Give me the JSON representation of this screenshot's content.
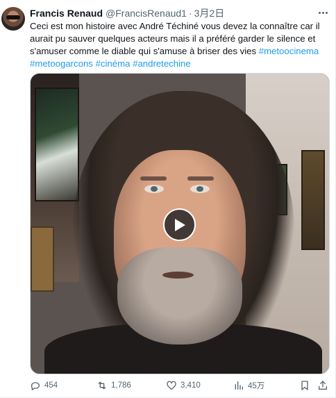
{
  "tweet": {
    "author_name": "Francis Renaud",
    "handle": "@FrancisRenaud1",
    "separator": "·",
    "date": "3月2日",
    "text": "Ceci est mon histoire avec André Téchiné vous devez la connaître car il aurait pu sauver quelques acteurs mais il a préféré garder le silence et s'amuser comme le diable qui s'amuse à briser des vies ",
    "hashtags": [
      "#metoocinema",
      "#metoogarcons",
      "#cinéma",
      "#andretechine"
    ],
    "stats": {
      "replies": "454",
      "retweets": "1,786",
      "likes": "3,410",
      "views": "45万"
    }
  },
  "icons": {
    "more": "more-dots-icon",
    "reply": "reply-icon",
    "retweet": "retweet-icon",
    "like": "heart-icon",
    "views": "bar-chart-icon",
    "bookmark": "bookmark-icon",
    "share": "share-icon",
    "play": "play-icon"
  },
  "colors": {
    "accent": "#1d9bf0",
    "text": "#0f1419",
    "muted": "#536471"
  }
}
